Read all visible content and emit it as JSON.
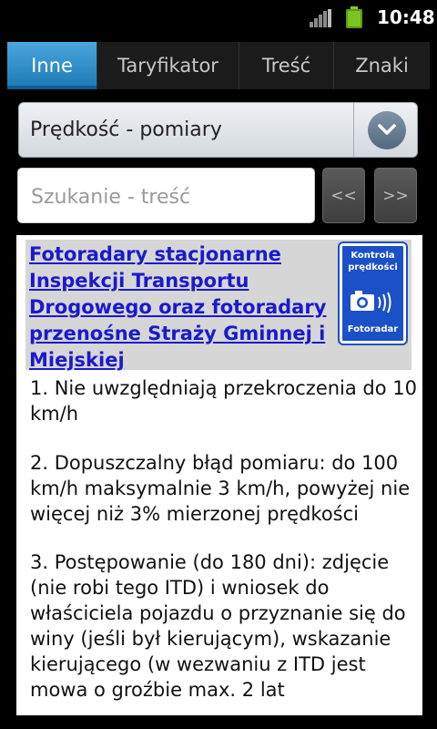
{
  "status_bar": {
    "time": "10:48"
  },
  "tabs": [
    {
      "label": "Inne",
      "active": true
    },
    {
      "label": "Taryfikator",
      "active": false
    },
    {
      "label": "Treść",
      "active": false
    },
    {
      "label": "Znaki",
      "active": false
    }
  ],
  "category_select": {
    "selected": "Prędkość - pomiary"
  },
  "search": {
    "placeholder": "Szukanie - treść",
    "value": ""
  },
  "nav": {
    "prev_label": "<<",
    "next_label": ">>"
  },
  "article": {
    "title": "Fotoradary stacjonarne Inspekcji Transportu Drogowego oraz fotoradary przenośne Straży Gminnej i Miejskiej",
    "sign": {
      "line1": "Kontrola prędkości",
      "line2": "Fotoradar",
      "bg_color": "#1c50c8"
    },
    "paragraphs": [
      "1. Nie uwzględniają przekroczenia do 10 km/h",
      "2. Dopuszczalny błąd pomiaru: do 100 km/h maksymalnie 3 km/h, powyżej nie więcej niż 3% mierzonej prędkości",
      "3. Postępowanie (do 180 dni): zdjęcie (nie robi tego ITD) i wniosek do właściciela pojazdu o przyznanie się do winy (jeśli był kierującym), wskazanie kierującego (w wezwaniu z ITD jest mowa o groźbie max. 2 lat"
    ]
  },
  "colors": {
    "tab_active": "#33a0e0",
    "link": "#1a1acc"
  }
}
